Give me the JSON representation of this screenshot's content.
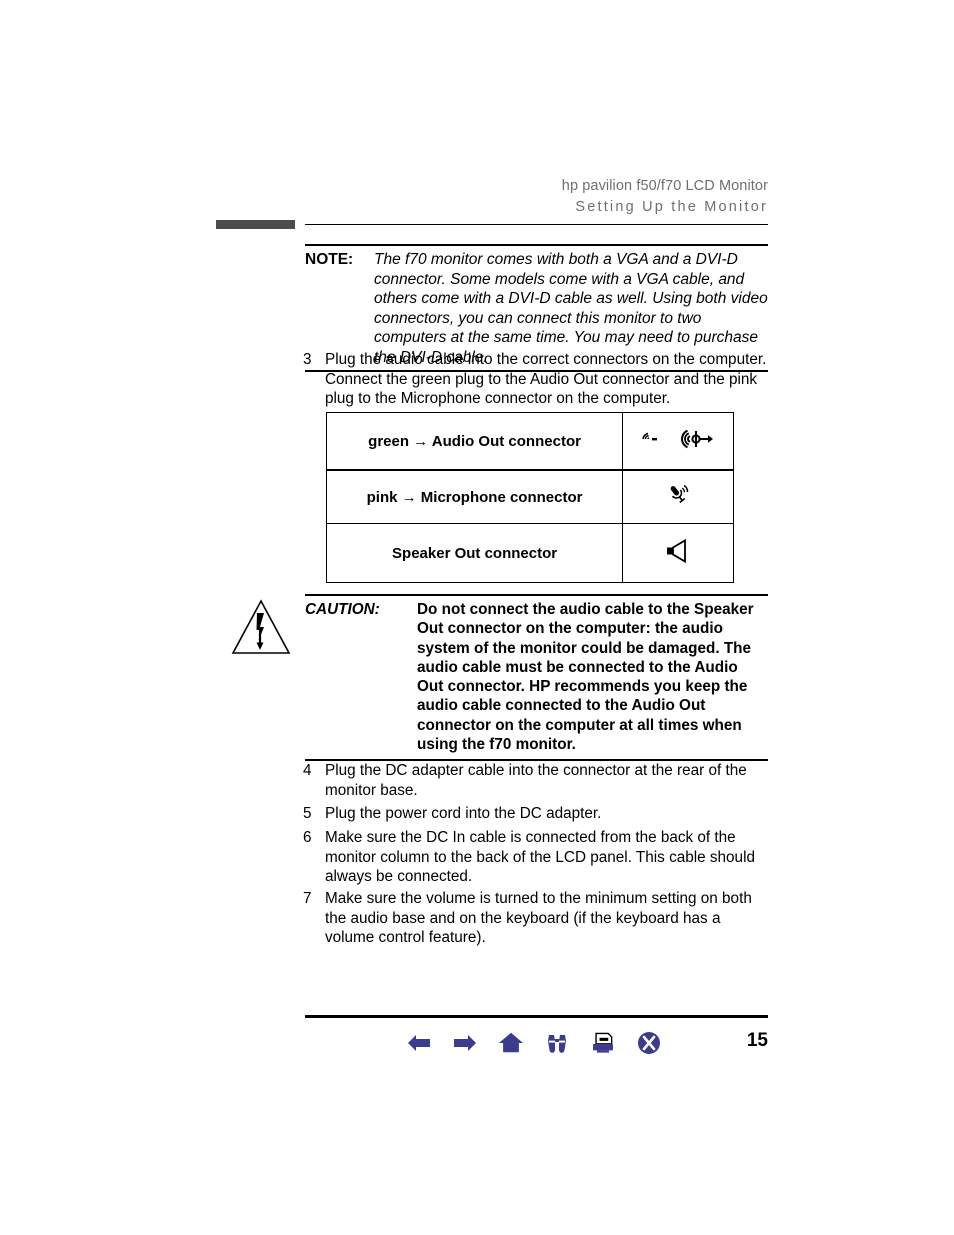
{
  "header": {
    "line1": "hp pavilion f50/f70 LCD Monitor",
    "line2": "Setting Up the Monitor"
  },
  "note": {
    "label": "NOTE:",
    "text": "The f70 monitor comes with both a VGA and a DVI-D connector. Some models come with a VGA cable, and others come with a DVI-D cable as well. Using both video connectors, you can connect this monitor to two computers at the same time. You may need to purchase the DVI-D cable."
  },
  "steps": [
    {
      "number": "3",
      "text": "Plug the audio cable into the correct connectors on the computer. Connect the green plug to the Audio Out connector and the pink plug to the Microphone connector on the computer."
    },
    {
      "number": "4",
      "text": "Plug the DC adapter cable into the connector at the rear of the monitor base."
    },
    {
      "number": "5",
      "text": "Plug the power cord into the DC adapter."
    },
    {
      "number": "6",
      "text": "Make sure the DC In cable is connected from the back of the monitor column to the back of the LCD panel. This cable should always be connected."
    },
    {
      "number": "7",
      "text": "Make sure the volume is turned to the minimum setting on both the audio base and on the keyboard (if the keyboard has a volume control feature)."
    }
  ],
  "connector_table": {
    "rows": [
      {
        "label": "green → Audio Out connector",
        "icons": [
          "sound-waves-small-icon",
          "line-out-icon"
        ]
      },
      {
        "label": "pink → Microphone connector",
        "icons": [
          "microphone-icon"
        ]
      },
      {
        "label": "Speaker Out connector",
        "icons": [
          "speaker-icon"
        ]
      }
    ]
  },
  "caution": {
    "icon": "warning-triangle-lightning-icon",
    "label": "CAUTION:",
    "text": "Do not connect the audio cable to the Speaker Out connector on the computer: the audio system of the monitor could be damaged. The audio cable must be connected to the Audio Out connector. HP recommends you keep the audio cable connected to the Audio Out connector on the computer at all times when using the f70 monitor."
  },
  "footer": {
    "page_number": "15",
    "nav": [
      {
        "name": "back-arrow",
        "label": "Back"
      },
      {
        "name": "forward-arrow",
        "label": "Forward"
      },
      {
        "name": "home",
        "label": "Home"
      },
      {
        "name": "search-binoculars",
        "label": "Search"
      },
      {
        "name": "print",
        "label": "Print"
      },
      {
        "name": "close",
        "label": "Close"
      }
    ]
  },
  "colors": {
    "nav_blue": "#3b3c8e",
    "header_gray": "#6f6f6f",
    "header_bar_gray": "#4d4d4d",
    "rule_black": "#000000"
  }
}
